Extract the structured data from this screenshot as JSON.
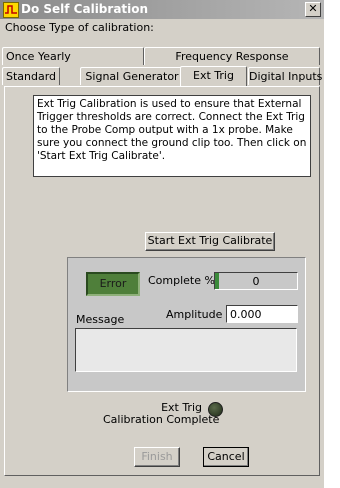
{
  "window": {
    "title": "Do Self Calibration",
    "close_glyph": "✕"
  },
  "choose_label": "Choose Type of calibration:",
  "tabs": {
    "row1": [
      {
        "label": "Once Yearly"
      },
      {
        "label": "Frequency Response"
      }
    ],
    "row2": [
      {
        "label": "Standard"
      },
      {
        "label": "Signal Generator"
      },
      {
        "label": "Ext Trig",
        "active": true
      },
      {
        "label": "Digital Inputs"
      }
    ]
  },
  "description": "Ext Trig Calibration is used to ensure  that External Trigger thresholds are correct. Connect the Ext Trig to the Probe Comp output with a 1x probe. Make sure you connect the ground clip too. Then click on 'Start Ext Trig Calibrate'.",
  "start_button_label": "Start Ext Trig Calibrate",
  "status": {
    "error_label": "Error",
    "complete_label": "Complete %",
    "complete_value": "0",
    "amplitude_label": "Amplitude",
    "amplitude_value": "0.000",
    "message_label": "Message",
    "message_text": ""
  },
  "completion": {
    "line1": "Ext Trig",
    "line2": "Calibration Complete"
  },
  "buttons": {
    "finish": "Finish",
    "cancel": "Cancel"
  },
  "colors": {
    "error_led": "#4f7f3a",
    "complete_led_off": "#2a3a22",
    "titlebar": "#9a9a9a"
  }
}
